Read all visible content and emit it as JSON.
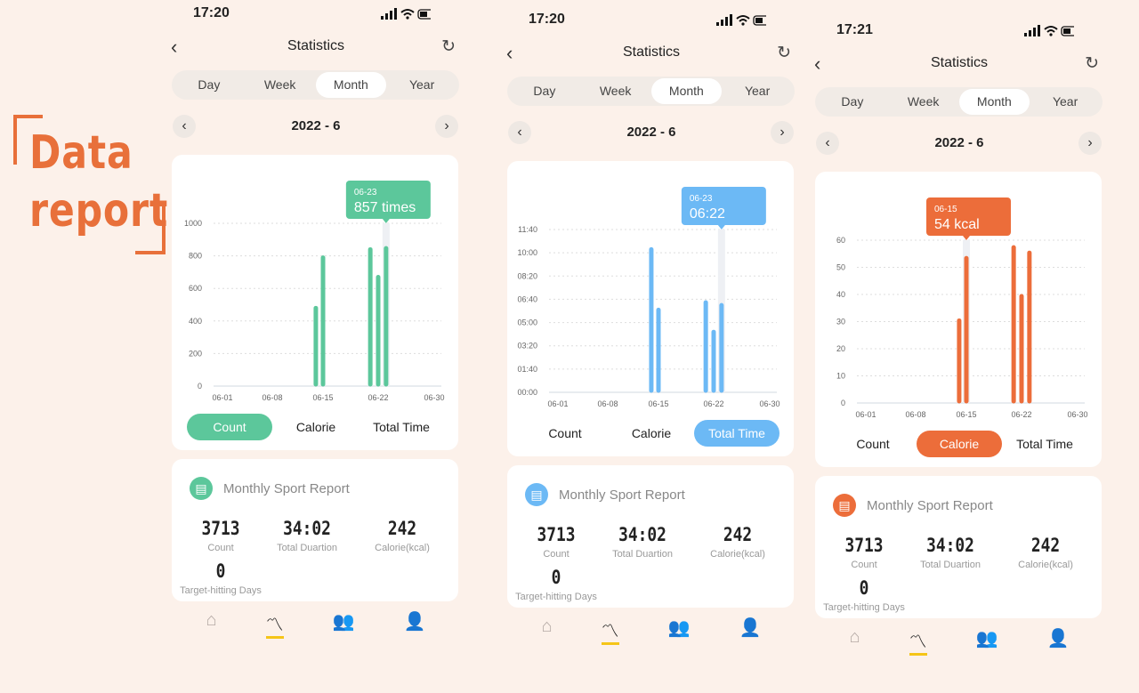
{
  "hero": {
    "line1": "Data",
    "line2": "report",
    "color": "#e8703a"
  },
  "common": {
    "title": "Statistics",
    "tabs": [
      "Day",
      "Week",
      "Month",
      "Year"
    ],
    "active_tab": "Month",
    "period": "2022 - 6",
    "toggles": [
      "Count",
      "Calorie",
      "Total Time"
    ],
    "report_title": "Monthly Sport Report",
    "stats": [
      {
        "value": "3713",
        "label": "Count"
      },
      {
        "value": "34:02",
        "label": "Total Duartion"
      },
      {
        "value": "242",
        "label": "Calorie(kcal)"
      },
      {
        "value": "0",
        "label": "Target-hitting Days"
      }
    ],
    "x_ticks": [
      "06-01",
      "06-08",
      "06-15",
      "06-22",
      "06-30"
    ],
    "icons": {
      "back": "chevron-left-icon",
      "refresh": "refresh-icon",
      "report": "document-icon",
      "nav": [
        "home-icon",
        "chart-icon",
        "group-icon",
        "profile-icon"
      ]
    }
  },
  "phones": [
    {
      "status_time": "17:20",
      "color": "#5cc79b",
      "active_toggle": "Count",
      "chart_data": {
        "type": "bar",
        "ylim": [
          0,
          1000
        ],
        "y_ticks": [
          "0",
          "200",
          "400",
          "600",
          "800",
          "1000"
        ],
        "x": [
          "06-14",
          "06-15",
          "06-21",
          "06-22",
          "06-23"
        ],
        "values": [
          490,
          800,
          850,
          680,
          857
        ],
        "tooltip": {
          "date": "06-23",
          "value": "857 times"
        }
      }
    },
    {
      "status_time": "17:20",
      "color": "#6cb9f5",
      "active_toggle": "Total Time",
      "chart_data": {
        "type": "bar",
        "ylim": [
          "00:00",
          "11:40"
        ],
        "y_ticks": [
          "00:00",
          "01:40",
          "03:20",
          "05:00",
          "06:40",
          "08:20",
          "10:00",
          "11:40"
        ],
        "x": [
          "06-14",
          "06-15",
          "06-21",
          "06-22",
          "06-23"
        ],
        "values": [
          "10:22",
          "06:02",
          "06:34",
          "04:27",
          "06:22"
        ],
        "tooltip": {
          "date": "06-23",
          "value": "06:22"
        }
      }
    },
    {
      "status_time": "17:21",
      "color": "#ec6d3a",
      "active_toggle": "Calorie",
      "chart_data": {
        "type": "bar",
        "ylim": [
          0,
          60
        ],
        "y_ticks": [
          "0",
          "10",
          "20",
          "30",
          "40",
          "50",
          "60"
        ],
        "x": [
          "06-14",
          "06-15",
          "06-21",
          "06-22",
          "06-23"
        ],
        "values": [
          31,
          54,
          58,
          40,
          56
        ],
        "tooltip": {
          "date": "06-15",
          "value": "54 kcal"
        }
      }
    }
  ]
}
